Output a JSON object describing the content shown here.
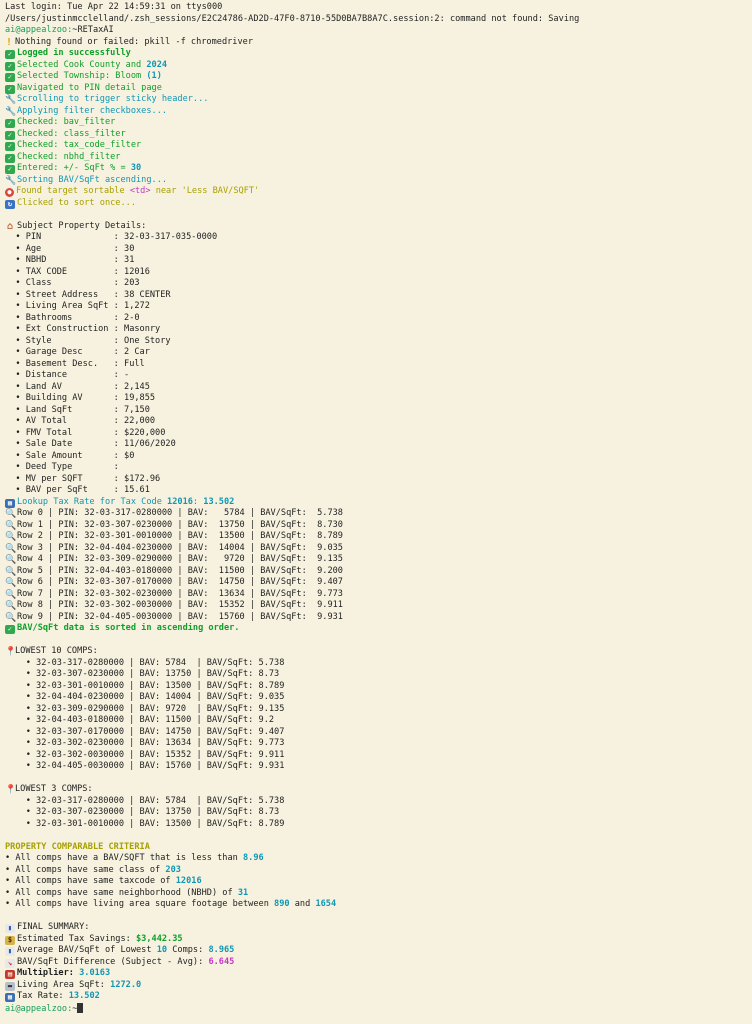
{
  "header": {
    "last_login": "Last login: Tue Apr 22 14:59:31 on ttys000",
    "zsh_err": "/Users/justinmcclelland/.zsh_sessions/E2C24786-AD2D-47F0-8710-55D0BA7B8A7C.session:2: command not found: Saving",
    "prompt_user": "ai@appealzoo:",
    "prompt_path": "~RETaxAI",
    "nothing_found": "Nothing found or failed: pkill -f chromedriver"
  },
  "steps": {
    "logged_in": "Logged in successfully",
    "county_prefix": "Selected Cook County and ",
    "county_year": "2024",
    "township_prefix": "Selected Township: Bloom ",
    "township_num": "(1)",
    "pin_page": "Navigated to PIN detail page",
    "scrolling": "Scrolling to trigger sticky header...",
    "applying": "Applying filter checkboxes...",
    "checked": [
      "Checked: bav_filter",
      "Checked: class_filter",
      "Checked: tax_code_filter",
      "Checked: nbhd_filter"
    ],
    "entered_prefix": "Entered: +/- SqFt % = ",
    "entered_val": "30",
    "sorting": "Sorting BAV/SqFt ascending...",
    "found_prefix": "Found target sortable ",
    "found_td": "<td>",
    "found_suffix": " near 'Less BAV/SQFT'",
    "clicked": "Clicked to sort once..."
  },
  "subject": {
    "title": "Subject Property Details:",
    "fields": [
      {
        "name": "PIN",
        "value": "32-03-317-035-0000",
        "align": "left"
      },
      {
        "name": "Age",
        "value": "30"
      },
      {
        "name": "NBHD",
        "value": "31"
      },
      {
        "name": "TAX CODE",
        "value": "12016"
      },
      {
        "name": "Class",
        "value": "203"
      },
      {
        "name": "Street Address",
        "value": "38 CENTER"
      },
      {
        "name": "Living Area SqFt",
        "value": "1,272"
      },
      {
        "name": "Bathrooms",
        "value": "2-0"
      },
      {
        "name": "Ext Construction",
        "value": "Masonry"
      },
      {
        "name": "Style",
        "value": "One Story"
      },
      {
        "name": "Garage Desc",
        "value": "2 Car"
      },
      {
        "name": "Basement Desc.",
        "value": "Full"
      },
      {
        "name": "Distance",
        "value": "-"
      },
      {
        "name": "Land AV",
        "value": "2,145"
      },
      {
        "name": "Building AV",
        "value": "19,855"
      },
      {
        "name": "Land SqFt",
        "value": "7,150"
      },
      {
        "name": "AV Total",
        "value": "22,000"
      },
      {
        "name": "FMV Total",
        "value": "$220,000"
      },
      {
        "name": "Sale Date",
        "value": "11/06/2020"
      },
      {
        "name": "Sale Amount",
        "value": "$0"
      },
      {
        "name": "Deed Type",
        "value": ""
      },
      {
        "name": "MV per SQFT",
        "value": "$172.96"
      },
      {
        "name": "BAV per SqFt",
        "value": "15.61"
      }
    ]
  },
  "lookup": {
    "prefix": "Lookup Tax Rate for Tax Code ",
    "code": "12016",
    "sep": ": ",
    "rate": "13.502"
  },
  "rows": [
    {
      "label": "Row 0",
      "pin": "32-03-317-0280000",
      "bav": "5784",
      "sqft": "5.738"
    },
    {
      "label": "Row 1",
      "pin": "32-03-307-0230000",
      "bav": "13750",
      "sqft": "8.730"
    },
    {
      "label": "Row 2",
      "pin": "32-03-301-0010000",
      "bav": "13500",
      "sqft": "8.789"
    },
    {
      "label": "Row 3",
      "pin": "32-04-404-0230000",
      "bav": "14004",
      "sqft": "9.035"
    },
    {
      "label": "Row 4",
      "pin": "32-03-309-0290000",
      "bav": "9720",
      "sqft": "9.135"
    },
    {
      "label": "Row 5",
      "pin": "32-04-403-0180000",
      "bav": "11500",
      "sqft": "9.200"
    },
    {
      "label": "Row 6",
      "pin": "32-03-307-0170000",
      "bav": "14750",
      "sqft": "9.407"
    },
    {
      "label": "Row 7",
      "pin": "32-03-302-0230000",
      "bav": "13634",
      "sqft": "9.773"
    },
    {
      "label": "Row 8",
      "pin": "32-03-302-0030000",
      "bav": "15352",
      "sqft": "9.911"
    },
    {
      "label": "Row 9",
      "pin": "32-04-405-0030000",
      "bav": "15760",
      "sqft": "9.931"
    }
  ],
  "sorted_msg": "BAV/SqFt data is sorted in ascending order.",
  "lowest10": {
    "title": "LOWEST 10 COMPS:",
    "items": [
      {
        "pin": "32-03-317-0280000",
        "bav": "5784",
        "sqft": "5.738"
      },
      {
        "pin": "32-03-307-0230000",
        "bav": "13750",
        "sqft": "8.73"
      },
      {
        "pin": "32-03-301-0010000",
        "bav": "13500",
        "sqft": "8.789"
      },
      {
        "pin": "32-04-404-0230000",
        "bav": "14004",
        "sqft": "9.035"
      },
      {
        "pin": "32-03-309-0290000",
        "bav": "9720",
        "sqft": "9.135"
      },
      {
        "pin": "32-04-403-0180000",
        "bav": "11500",
        "sqft": "9.2"
      },
      {
        "pin": "32-03-307-0170000",
        "bav": "14750",
        "sqft": "9.407"
      },
      {
        "pin": "32-03-302-0230000",
        "bav": "13634",
        "sqft": "9.773"
      },
      {
        "pin": "32-03-302-0030000",
        "bav": "15352",
        "sqft": "9.911"
      },
      {
        "pin": "32-04-405-0030000",
        "bav": "15760",
        "sqft": "9.931"
      }
    ]
  },
  "lowest3": {
    "title": "LOWEST 3 COMPS:",
    "items": [
      {
        "pin": "32-03-317-0280000",
        "bav": "5784",
        "sqft": "5.738"
      },
      {
        "pin": "32-03-307-0230000",
        "bav": "13750",
        "sqft": "8.73"
      },
      {
        "pin": "32-03-301-0010000",
        "bav": "13500",
        "sqft": "8.789"
      }
    ]
  },
  "criteria": {
    "title": "PROPERTY COMPARABLE CRITERIA",
    "c1_prefix": "• All comps have a BAV/SQFT that is less than ",
    "c1_val": "8.96",
    "c2_prefix": "• All comps have same class of ",
    "c2_val": "203",
    "c3_prefix": "• All comps have same taxcode of ",
    "c3_val": "12016",
    "c4_prefix": "• All comps have same neighborhood (NBHD) of ",
    "c4_val": "31",
    "c5_prefix": "• All comps have living area square footage between ",
    "c5_a": "890",
    "c5_and": " and ",
    "c5_b": "1654"
  },
  "summary": {
    "title": "FINAL SUMMARY:",
    "savings_label": "Estimated Tax Savings: ",
    "savings_val": "$3,442.35",
    "avg_label_a": "Average BAV/SqFt of Lowest ",
    "avg_label_n": "10",
    "avg_label_b": " Comps: ",
    "avg_val": "8.965",
    "diff_label": "BAV/SqFt Difference (Subject - Avg): ",
    "diff_val": "6.645",
    "mult_label": "Multiplier: ",
    "mult_val": "3.0163",
    "area_label": "Living Area SqFt: ",
    "area_val": "1272.0",
    "rate_label": "Tax Rate: ",
    "rate_val": "13.502"
  },
  "final_prompt": {
    "user": "ai@appealzoo:",
    "path": "~"
  },
  "icons": {
    "check": "check-icon",
    "warn": "warning-icon",
    "wrench": "wrench-icon",
    "target": "target-icon",
    "cycle": "cycle-icon",
    "house": "house-icon",
    "abacus": "abacus-icon",
    "mag": "magnifier-icon",
    "pin": "pushpin-icon",
    "chart": "bar-chart-icon",
    "money": "money-bag-icon",
    "down": "chart-down-icon",
    "cal": "calendar-icon",
    "ruler": "ruler-icon"
  },
  "colors": {
    "background": "#f6f2df",
    "green": "#0fa02a",
    "cyan": "#1296b3",
    "yellow": "#a8a000",
    "magenta": "#c238c2"
  }
}
